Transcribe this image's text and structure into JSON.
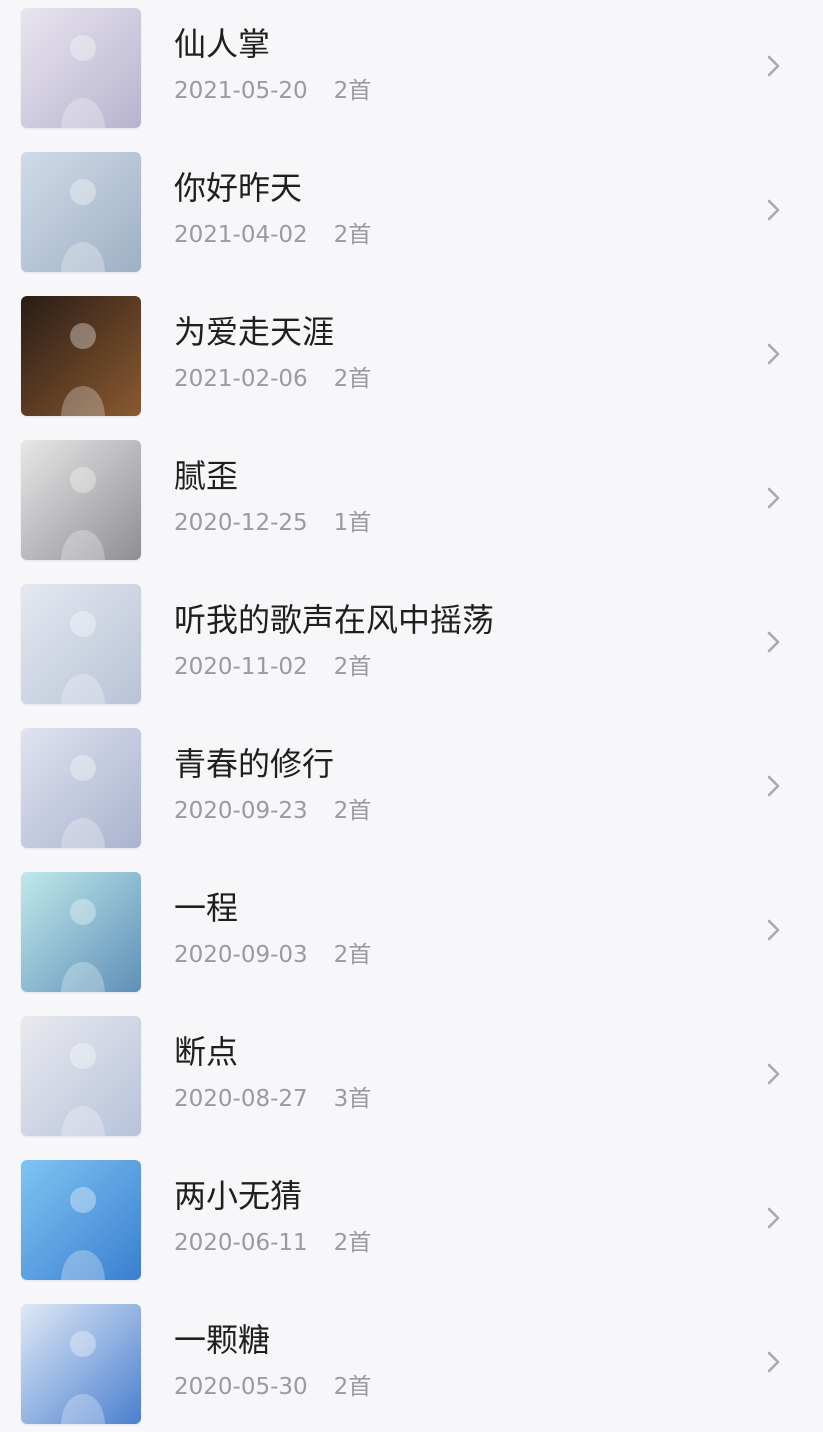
{
  "albums": [
    {
      "title": "仙人掌",
      "date": "2021-05-20",
      "count": "2首",
      "cover_colors": [
        "#e9e5ef",
        "#b7b3cf"
      ],
      "cover_icon": "album-cover-image"
    },
    {
      "title": "你好昨天",
      "date": "2021-04-02",
      "count": "2首",
      "cover_colors": [
        "#cfdbe9",
        "#9fb0c4"
      ],
      "cover_icon": "album-cover-image"
    },
    {
      "title": "为爱走天涯",
      "date": "2021-02-06",
      "count": "2首",
      "cover_colors": [
        "#2a1c16",
        "#8a5a30"
      ],
      "cover_icon": "album-cover-image"
    },
    {
      "title": "腻歪",
      "date": "2020-12-25",
      "count": "1首",
      "cover_colors": [
        "#e7e7e8",
        "#8f8e92"
      ],
      "cover_icon": "album-cover-image"
    },
    {
      "title": "听我的歌声在风中摇荡",
      "date": "2020-11-02",
      "count": "2首",
      "cover_colors": [
        "#e4e8f0",
        "#b9c3d6"
      ],
      "cover_icon": "album-cover-image"
    },
    {
      "title": "青春的修行",
      "date": "2020-09-23",
      "count": "2首",
      "cover_colors": [
        "#dfe3ef",
        "#aab3cf"
      ],
      "cover_icon": "album-cover-image"
    },
    {
      "title": "一程",
      "date": "2020-09-03",
      "count": "2首",
      "cover_colors": [
        "#bfe9ea",
        "#5e8fb8"
      ],
      "cover_icon": "album-cover-image"
    },
    {
      "title": "断点",
      "date": "2020-08-27",
      "count": "3首",
      "cover_colors": [
        "#e9eaef",
        "#b7c2da"
      ],
      "cover_icon": "album-cover-image"
    },
    {
      "title": "两小无猜",
      "date": "2020-06-11",
      "count": "2首",
      "cover_colors": [
        "#7fc4f2",
        "#3a7fd0"
      ],
      "cover_icon": "album-cover-image"
    },
    {
      "title": "一颗糖",
      "date": "2020-05-30",
      "count": "2首",
      "cover_colors": [
        "#dfe9f6",
        "#4b7fcf"
      ],
      "cover_icon": "album-cover-image"
    }
  ],
  "chevron_icon": "chevron-right-icon",
  "colors": {
    "background": "#f7f7f9",
    "title_text": "#1f1f1f",
    "meta_text": "#9a9a9f",
    "chevron": "#a9a9ae"
  }
}
